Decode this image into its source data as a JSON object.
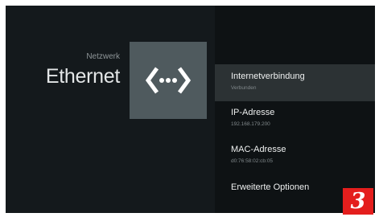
{
  "header": {
    "breadcrumb": "Netzwerk",
    "title": "Ethernet"
  },
  "icon": {
    "name": "ethernet-icon"
  },
  "menu": {
    "items": [
      {
        "label": "Internetverbindung",
        "value": "Verbunden"
      },
      {
        "label": "IP-Adresse",
        "value": "192.168.179.200"
      },
      {
        "label": "MAC-Adresse",
        "value": "d0:76:58:02:cb:05"
      },
      {
        "label": "Erweiterte Optionen"
      }
    ]
  },
  "badge": {
    "text": "3"
  },
  "colors": {
    "background": "#14191c",
    "panel": "#0e1214",
    "focused_item": "#2c3234",
    "tile": "#4f5a5e",
    "badge": "#e41e1d"
  }
}
